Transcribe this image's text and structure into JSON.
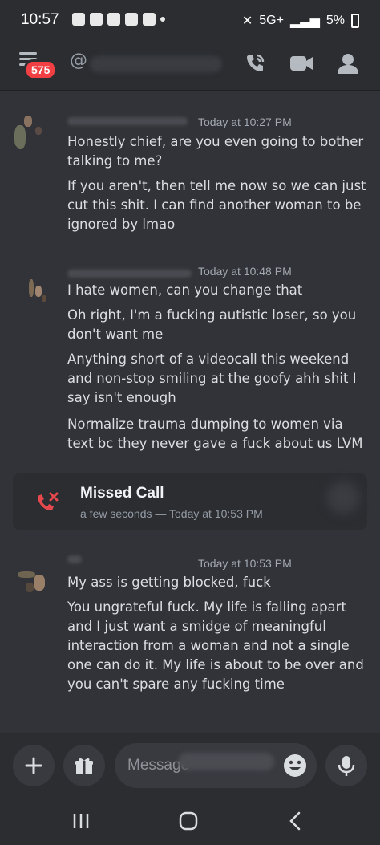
{
  "status_bar": {
    "time": "10:57",
    "network": "5G+",
    "battery": "5%"
  },
  "header": {
    "notification_count": "575",
    "at_symbol": "@"
  },
  "messages": [
    {
      "timestamp": "Today at 10:27 PM",
      "lines": [
        "Honestly chief, are you even going to bother talking to me?",
        "If you aren't, then tell me now so we can just cut this shit. I can find another woman to be ignored by lmao"
      ]
    },
    {
      "timestamp": "Today at 10:48 PM",
      "lines": [
        "I hate women, can you change that",
        "Oh right, I'm a fucking autistic loser, so you don't want me",
        "Anything short of a videocall this weekend and non-stop smiling at the goofy ahh shit I say isn't enough",
        "Normalize trauma dumping to women via text bc they never gave a fuck about us LVM"
      ]
    },
    {
      "timestamp": "Today at 10:53 PM",
      "lines": [
        "My ass is getting blocked, fuck",
        "You ungrateful fuck. My life is falling apart and I just want a smidge of meaningful interaction from a woman and not a single one can do it. My life is about to be over and you can't spare any fucking time"
      ]
    }
  ],
  "missed_call": {
    "title": "Missed Call",
    "subtitle": "a few seconds — Today at 10:53 PM"
  },
  "composer": {
    "placeholder": "Message"
  },
  "colors": {
    "background": "#313338",
    "panel": "#2b2d31",
    "danger": "#f23f43",
    "missed_call_icon": "#e5484d"
  }
}
